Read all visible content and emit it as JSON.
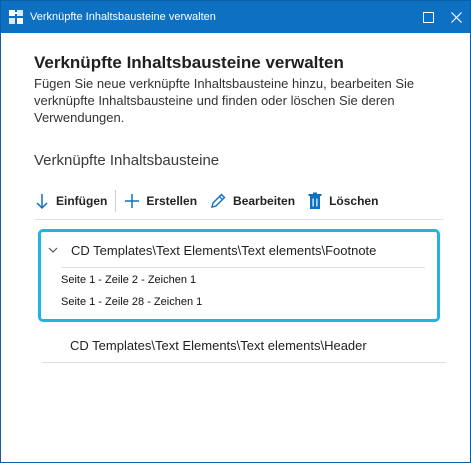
{
  "window": {
    "title": "Verknüpfte Inhaltsbausteine verwalten",
    "maximize_glyph": "☐",
    "close_glyph": "✕"
  },
  "panel": {
    "heading": "Verknüpfte Inhaltsbausteine verwalten",
    "description": "Fügen Sie neue verknüpfte Inhaltsbausteine hinzu, bearbeiten Sie verknüpfte Inhaltsbausteine und finden oder löschen Sie deren Verwendungen.",
    "section_label": "Verknüpfte Inhaltsbausteine"
  },
  "toolbar": {
    "insert_label": "Einfügen",
    "create_label": "Erstellen",
    "edit_label": "Bearbeiten",
    "delete_label": "Löschen"
  },
  "items": [
    {
      "path": "CD Templates\\Text Elements\\Text elements\\Footnote",
      "expanded": true,
      "usages": [
        "Seite 1 - Zeile 2 - Zeichen 1",
        "Seite 1 - Zeile 28 - Zeichen 1"
      ]
    },
    {
      "path": "CD Templates\\Text Elements\\Text elements\\Header",
      "expanded": false,
      "usages": []
    }
  ],
  "colors": {
    "titlebar": "#0e70c0",
    "focus_border": "#22b4e0",
    "accent_icon": "#0e70c0"
  }
}
